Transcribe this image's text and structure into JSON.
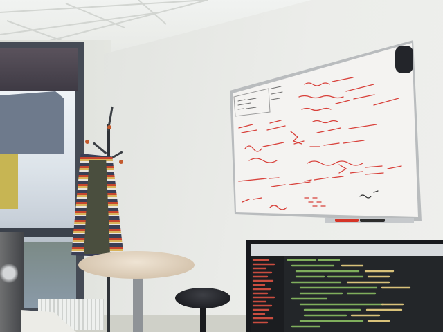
{
  "scene": {
    "description_tags": [
      "window-view",
      "coat-stand",
      "whiteboard",
      "round-table",
      "stool",
      "monitor",
      "pc-tower"
    ],
    "colors": {
      "wall": "#eceeea",
      "whiteboard": "#f4f3f1",
      "marker_ink": "#d8403a",
      "window_frame": "#454b55",
      "monitor_bezel": "#17191d",
      "code_background": "#232629"
    }
  }
}
